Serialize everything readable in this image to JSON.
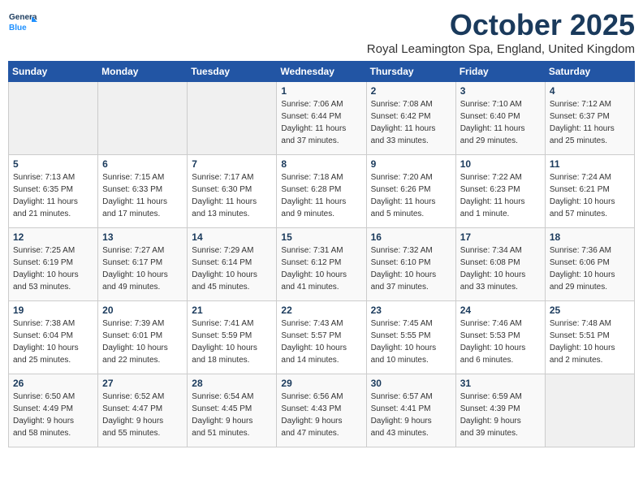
{
  "logo": {
    "line1": "General",
    "line2": "Blue"
  },
  "title": "October 2025",
  "subtitle": "Royal Leamington Spa, England, United Kingdom",
  "days_of_week": [
    "Sunday",
    "Monday",
    "Tuesday",
    "Wednesday",
    "Thursday",
    "Friday",
    "Saturday"
  ],
  "weeks": [
    [
      {
        "day": "",
        "info": ""
      },
      {
        "day": "",
        "info": ""
      },
      {
        "day": "",
        "info": ""
      },
      {
        "day": "1",
        "info": "Sunrise: 7:06 AM\nSunset: 6:44 PM\nDaylight: 11 hours\nand 37 minutes."
      },
      {
        "day": "2",
        "info": "Sunrise: 7:08 AM\nSunset: 6:42 PM\nDaylight: 11 hours\nand 33 minutes."
      },
      {
        "day": "3",
        "info": "Sunrise: 7:10 AM\nSunset: 6:40 PM\nDaylight: 11 hours\nand 29 minutes."
      },
      {
        "day": "4",
        "info": "Sunrise: 7:12 AM\nSunset: 6:37 PM\nDaylight: 11 hours\nand 25 minutes."
      }
    ],
    [
      {
        "day": "5",
        "info": "Sunrise: 7:13 AM\nSunset: 6:35 PM\nDaylight: 11 hours\nand 21 minutes."
      },
      {
        "day": "6",
        "info": "Sunrise: 7:15 AM\nSunset: 6:33 PM\nDaylight: 11 hours\nand 17 minutes."
      },
      {
        "day": "7",
        "info": "Sunrise: 7:17 AM\nSunset: 6:30 PM\nDaylight: 11 hours\nand 13 minutes."
      },
      {
        "day": "8",
        "info": "Sunrise: 7:18 AM\nSunset: 6:28 PM\nDaylight: 11 hours\nand 9 minutes."
      },
      {
        "day": "9",
        "info": "Sunrise: 7:20 AM\nSunset: 6:26 PM\nDaylight: 11 hours\nand 5 minutes."
      },
      {
        "day": "10",
        "info": "Sunrise: 7:22 AM\nSunset: 6:23 PM\nDaylight: 11 hours\nand 1 minute."
      },
      {
        "day": "11",
        "info": "Sunrise: 7:24 AM\nSunset: 6:21 PM\nDaylight: 10 hours\nand 57 minutes."
      }
    ],
    [
      {
        "day": "12",
        "info": "Sunrise: 7:25 AM\nSunset: 6:19 PM\nDaylight: 10 hours\nand 53 minutes."
      },
      {
        "day": "13",
        "info": "Sunrise: 7:27 AM\nSunset: 6:17 PM\nDaylight: 10 hours\nand 49 minutes."
      },
      {
        "day": "14",
        "info": "Sunrise: 7:29 AM\nSunset: 6:14 PM\nDaylight: 10 hours\nand 45 minutes."
      },
      {
        "day": "15",
        "info": "Sunrise: 7:31 AM\nSunset: 6:12 PM\nDaylight: 10 hours\nand 41 minutes."
      },
      {
        "day": "16",
        "info": "Sunrise: 7:32 AM\nSunset: 6:10 PM\nDaylight: 10 hours\nand 37 minutes."
      },
      {
        "day": "17",
        "info": "Sunrise: 7:34 AM\nSunset: 6:08 PM\nDaylight: 10 hours\nand 33 minutes."
      },
      {
        "day": "18",
        "info": "Sunrise: 7:36 AM\nSunset: 6:06 PM\nDaylight: 10 hours\nand 29 minutes."
      }
    ],
    [
      {
        "day": "19",
        "info": "Sunrise: 7:38 AM\nSunset: 6:04 PM\nDaylight: 10 hours\nand 25 minutes."
      },
      {
        "day": "20",
        "info": "Sunrise: 7:39 AM\nSunset: 6:01 PM\nDaylight: 10 hours\nand 22 minutes."
      },
      {
        "day": "21",
        "info": "Sunrise: 7:41 AM\nSunset: 5:59 PM\nDaylight: 10 hours\nand 18 minutes."
      },
      {
        "day": "22",
        "info": "Sunrise: 7:43 AM\nSunset: 5:57 PM\nDaylight: 10 hours\nand 14 minutes."
      },
      {
        "day": "23",
        "info": "Sunrise: 7:45 AM\nSunset: 5:55 PM\nDaylight: 10 hours\nand 10 minutes."
      },
      {
        "day": "24",
        "info": "Sunrise: 7:46 AM\nSunset: 5:53 PM\nDaylight: 10 hours\nand 6 minutes."
      },
      {
        "day": "25",
        "info": "Sunrise: 7:48 AM\nSunset: 5:51 PM\nDaylight: 10 hours\nand 2 minutes."
      }
    ],
    [
      {
        "day": "26",
        "info": "Sunrise: 6:50 AM\nSunset: 4:49 PM\nDaylight: 9 hours\nand 58 minutes."
      },
      {
        "day": "27",
        "info": "Sunrise: 6:52 AM\nSunset: 4:47 PM\nDaylight: 9 hours\nand 55 minutes."
      },
      {
        "day": "28",
        "info": "Sunrise: 6:54 AM\nSunset: 4:45 PM\nDaylight: 9 hours\nand 51 minutes."
      },
      {
        "day": "29",
        "info": "Sunrise: 6:56 AM\nSunset: 4:43 PM\nDaylight: 9 hours\nand 47 minutes."
      },
      {
        "day": "30",
        "info": "Sunrise: 6:57 AM\nSunset: 4:41 PM\nDaylight: 9 hours\nand 43 minutes."
      },
      {
        "day": "31",
        "info": "Sunrise: 6:59 AM\nSunset: 4:39 PM\nDaylight: 9 hours\nand 39 minutes."
      },
      {
        "day": "",
        "info": ""
      }
    ]
  ]
}
